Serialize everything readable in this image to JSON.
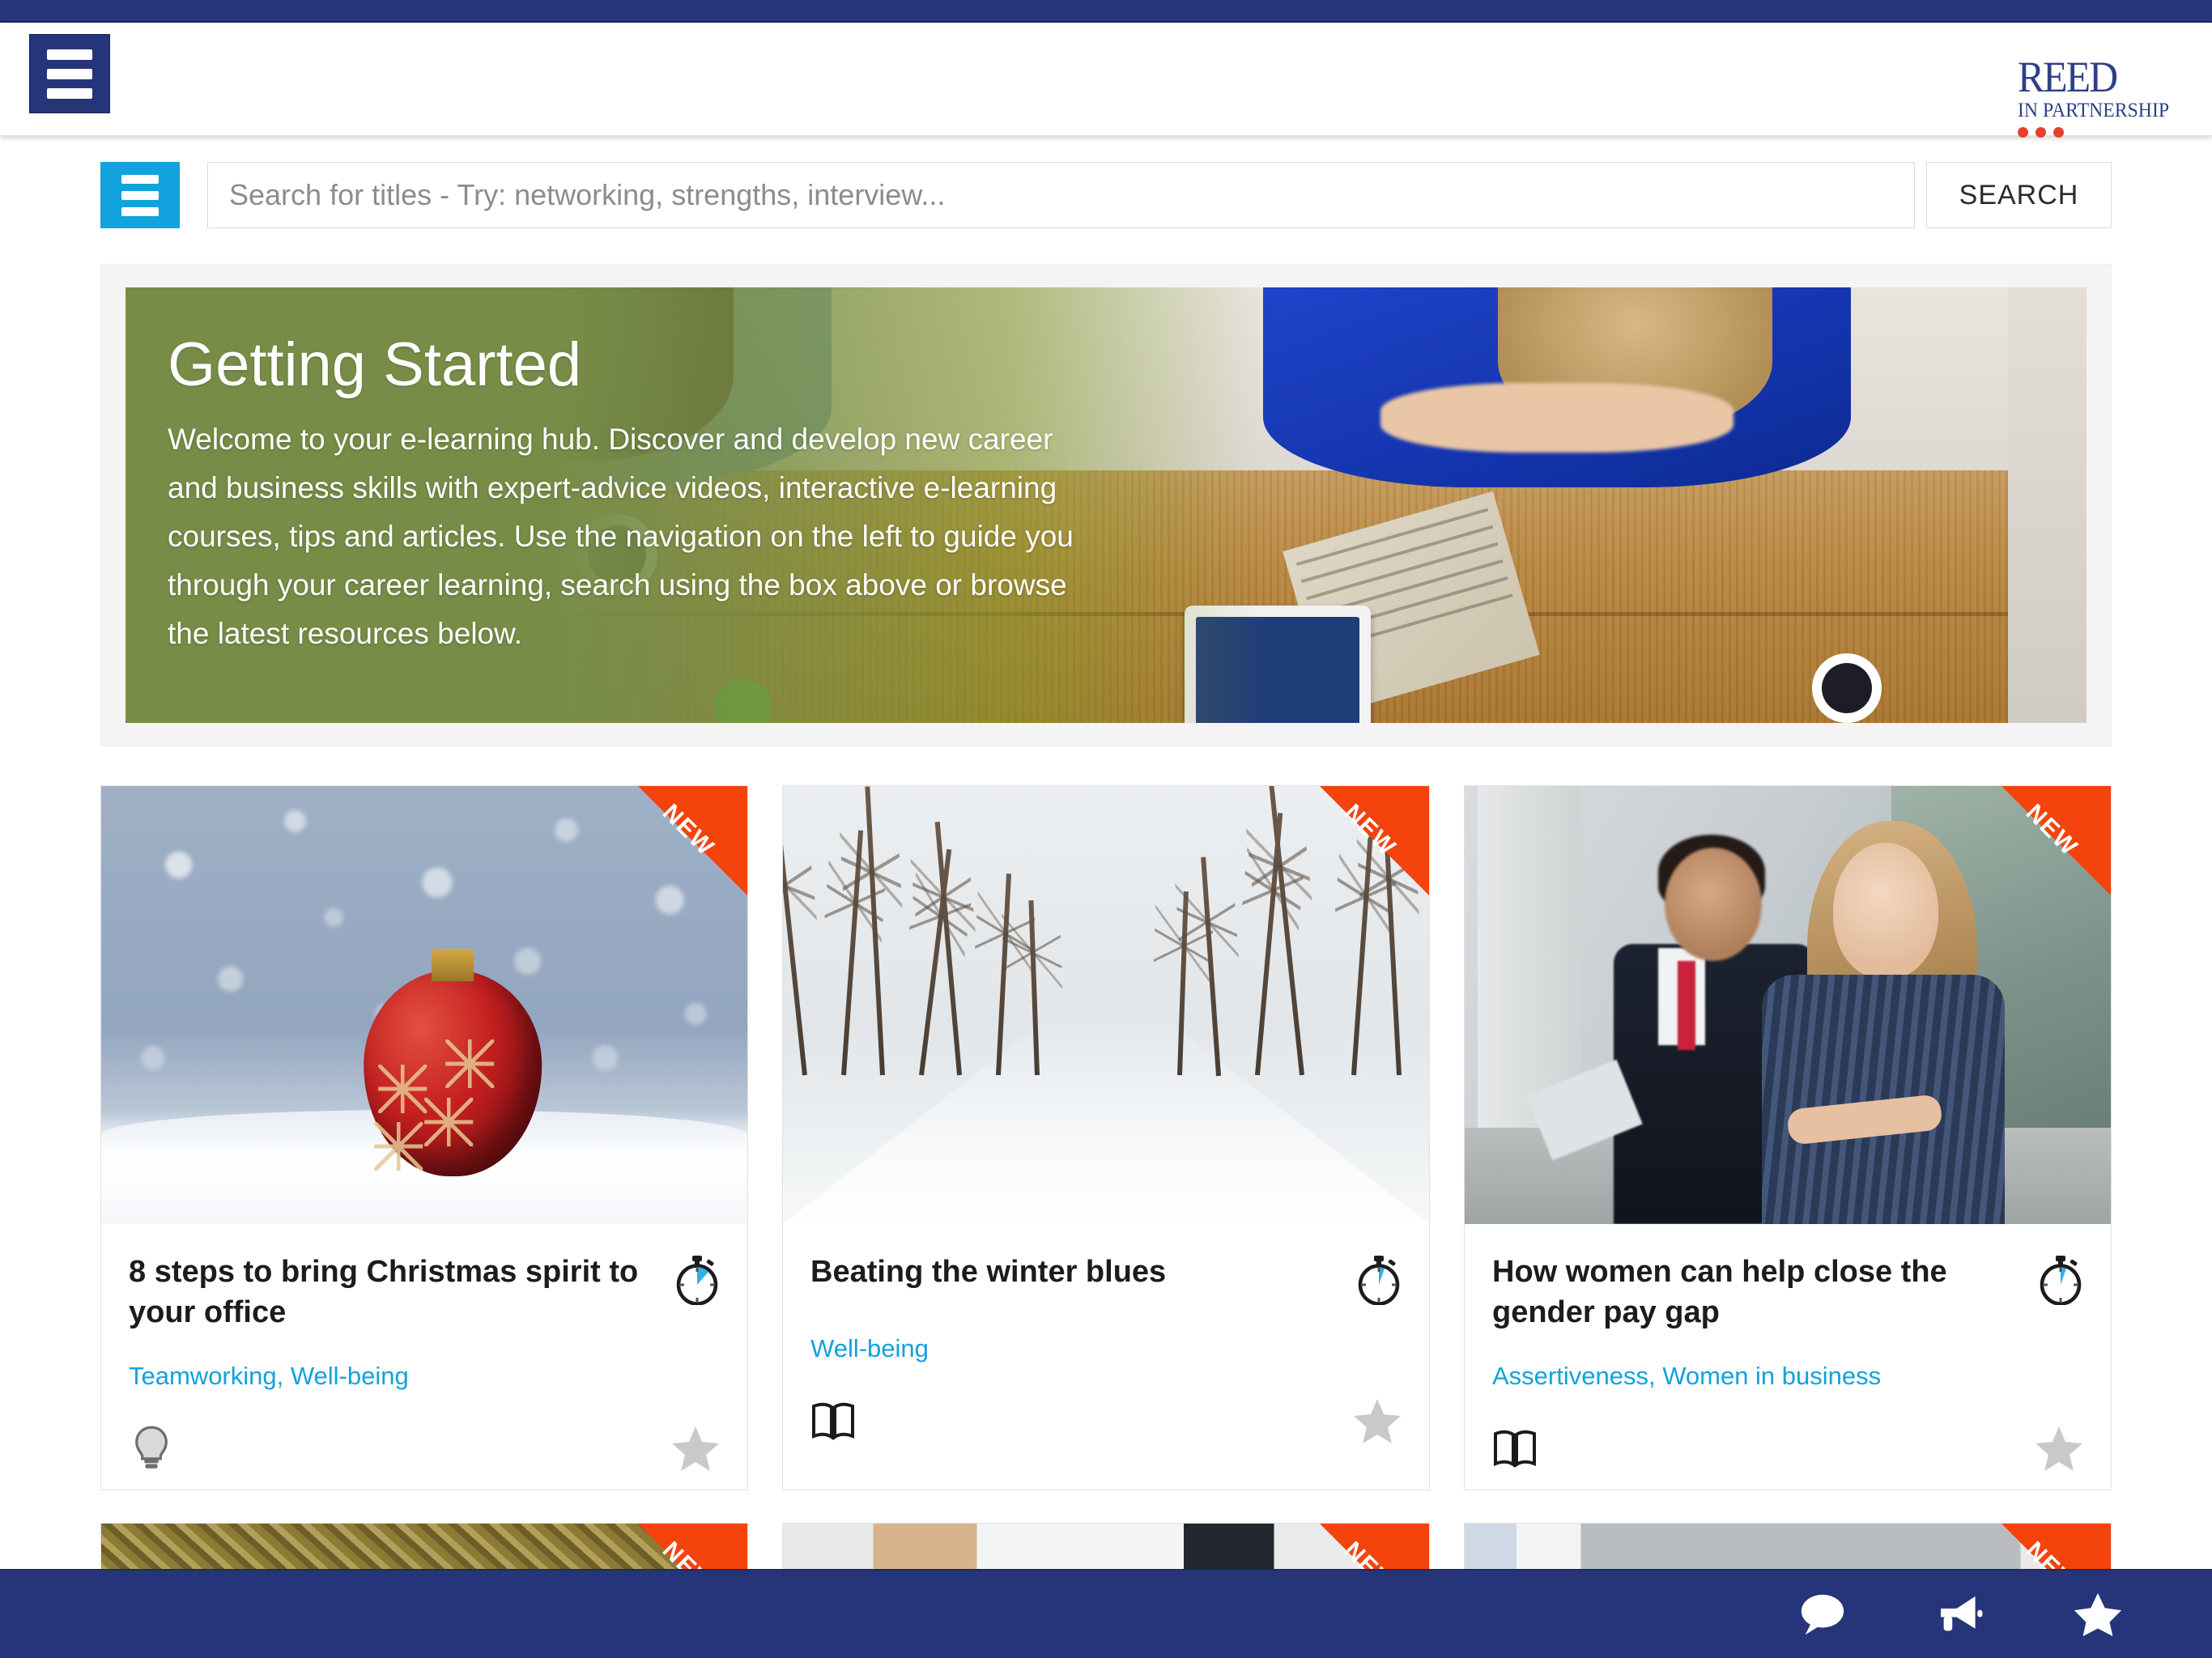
{
  "header": {
    "menu_button_label": "Menu",
    "logo": {
      "line1": "REED",
      "line2": "IN PARTNERSHIP",
      "dot_color": "#e8402a",
      "text_color": "#2e3f86"
    }
  },
  "search": {
    "menu_button_label": "Menu",
    "placeholder": "Search for titles - Try: networking, strengths, interview...",
    "value": "",
    "button_label": "SEARCH",
    "accent_color": "#12a2dd"
  },
  "hero": {
    "title": "Getting Started",
    "body": "Welcome to your e-learning hub. Discover and develop new career and business skills with expert-advice videos, interactive e-learning courses, tips and articles. Use the navigation on the left to guide you through your career learning, search using the box above or browse the latest resources below.",
    "overlay_color": "#778d47"
  },
  "ribbon": {
    "label": "NEW",
    "color": "#f4430c"
  },
  "cards": [
    {
      "title": "8 steps to bring Christmas spirit to your office",
      "tags": "Teamworking, Well-being",
      "type_icon": "lightbulb-icon",
      "favourite_icon": "star-icon",
      "duration_icon": "stopwatch-icon",
      "badge": "NEW",
      "image_alt": "red christmas bauble in snow"
    },
    {
      "title": "Beating the winter blues",
      "tags": "Well-being",
      "type_icon": "book-icon",
      "favourite_icon": "star-icon",
      "duration_icon": "stopwatch-icon",
      "badge": "NEW",
      "image_alt": "snow covered tree lined road"
    },
    {
      "title": "How women can help close the gender pay gap",
      "tags": "Assertiveness, Women in business",
      "type_icon": "book-icon",
      "favourite_icon": "star-icon",
      "duration_icon": "stopwatch-icon",
      "badge": "NEW",
      "image_alt": "businesswoman and businessman outside office"
    }
  ],
  "cards_row2": [
    {
      "badge": "NEW",
      "image_alt": "gold glitter"
    },
    {
      "badge": "NEW",
      "image_alt": "blonde woman and man in suit"
    },
    {
      "badge": "NEW",
      "image_alt": "office interior"
    }
  ],
  "bottom_bar": {
    "items": [
      {
        "icon": "chat-icon",
        "label": "Chat"
      },
      {
        "icon": "megaphone-icon",
        "label": "Announcements"
      },
      {
        "icon": "star-icon",
        "label": "Favourites"
      }
    ],
    "color": "#26357a"
  },
  "tag_color": "#12a2dd"
}
